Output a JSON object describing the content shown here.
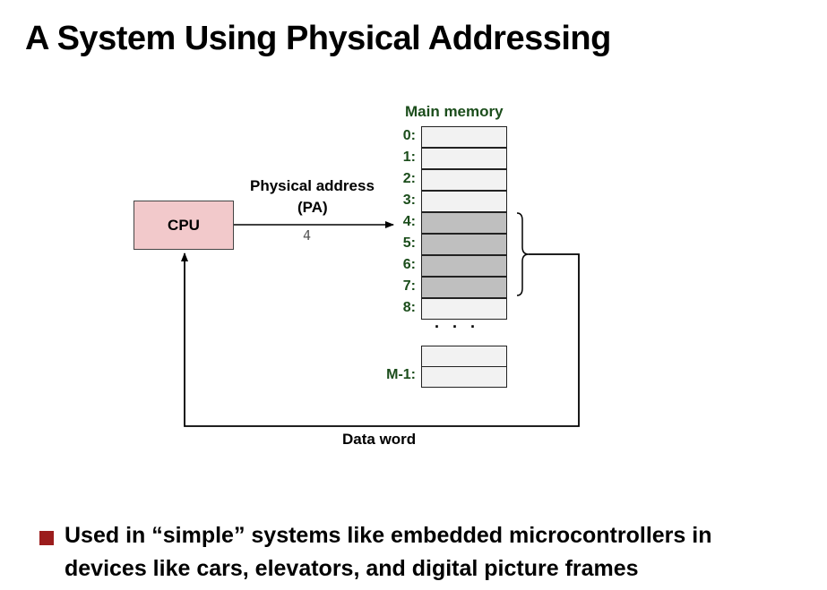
{
  "title": "A System Using Physical Addressing",
  "cpu_label": "CPU",
  "address_label_line1": "Physical address",
  "address_label_line2": "(PA)",
  "address_value": "4",
  "memory_title": "Main memory",
  "memory_rows": [
    {
      "label": "0:",
      "highlighted": false
    },
    {
      "label": "1:",
      "highlighted": false
    },
    {
      "label": "2:",
      "highlighted": false
    },
    {
      "label": "3:",
      "highlighted": false
    },
    {
      "label": "4:",
      "highlighted": true
    },
    {
      "label": "5:",
      "highlighted": true
    },
    {
      "label": "6:",
      "highlighted": true
    },
    {
      "label": "7:",
      "highlighted": true
    },
    {
      "label": "8:",
      "highlighted": false
    }
  ],
  "ellipsis": ". . .",
  "last_row_label": "M-1:",
  "data_word_label": "Data word",
  "bullet": "Used in “simple” systems like embedded microcontrollers in devices like cars, elevators, and digital picture frames",
  "colors": {
    "cpu_fill": "#f2c9cb",
    "highlight_cell": "#bfbfbf",
    "address_text": "#1b4d1b",
    "bullet_marker": "#9b1c1c"
  }
}
